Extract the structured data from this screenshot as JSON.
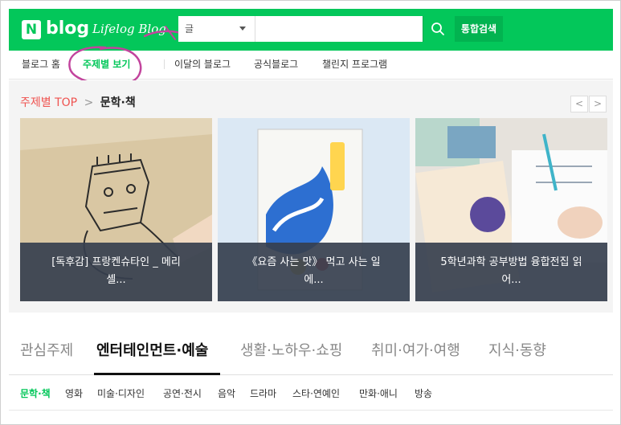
{
  "header": {
    "logo_n": "N",
    "logo_blog": "blog",
    "logo_life": "Lifelog Blog",
    "search_category": "글",
    "search_value": "",
    "search_placeholder": "",
    "total_search_label": "통합검색"
  },
  "nav": {
    "items": [
      "블로그 홈",
      "주제별 보기",
      "이달의 블로그",
      "공식블로그",
      "챌린지 프로그램"
    ]
  },
  "topic": {
    "title": "주제별 TOP",
    "chevron": ">",
    "sub": "문학·책",
    "prev": "<",
    "next": ">"
  },
  "cards": [
    {
      "caption": "[독후감] 프랑켄슈타인 _ 메리 셸..."
    },
    {
      "caption": "《요즘 사는 맛》 먹고 사는 일에..."
    },
    {
      "caption": "5학년과학 공부방법 융합전집 읽어..."
    }
  ],
  "tabs": [
    "관심주제",
    "엔터테인먼트·예술",
    "생활·노하우·쇼핑",
    "취미·여가·여행",
    "지식·동향"
  ],
  "subtabs": [
    "문학·책",
    "영화",
    "미술·디자인",
    "공연·전시",
    "음악",
    "드라마",
    "스타·연예인",
    "만화·애니",
    "방송"
  ],
  "colors": {
    "brand_green": "#03c75a",
    "accent_pink": "#c2449d",
    "topic_red": "#ef5350"
  }
}
